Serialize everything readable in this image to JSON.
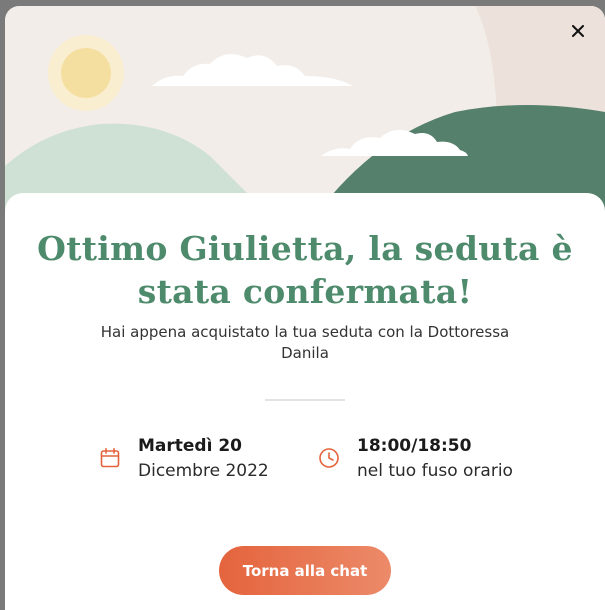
{
  "title": "Ottimo Giulietta, la seduta è stata confermata!",
  "subtitle": "Hai appena acquistato la tua seduta con la Dottoressa Danila",
  "date": {
    "day": "Martedì 20",
    "month_year": "Dicembre 2022"
  },
  "time": {
    "range": "18:00/18:50",
    "note": "nel tuo fuso orario"
  },
  "cta_label": "Torna alla chat",
  "icons": {
    "close": "close-icon",
    "date": "calendar-icon",
    "time": "clock-icon"
  },
  "colors": {
    "accent_green": "#4e8a6c",
    "accent_orange": "#e4643d",
    "hill_dark": "#55806c",
    "hill_light": "#cfe1d4",
    "sun": "#f7e6b3"
  }
}
